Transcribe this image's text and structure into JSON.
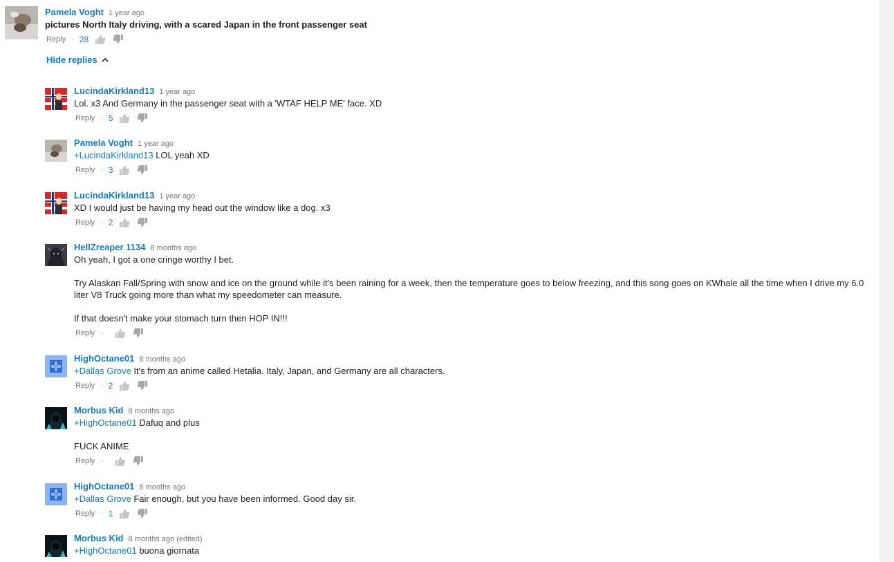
{
  "ui": {
    "reply_label": "Reply",
    "hide_replies_label": "Hide replies"
  },
  "top_comment": {
    "author": "Pamela Voght",
    "time": "1 year ago",
    "text": "pictures North Italy driving, with a scared Japan in the front passenger seat",
    "likes": "28"
  },
  "replies": [
    {
      "author": "LucindaKirkland13",
      "time": "1 year ago",
      "lines": [
        "Lol. x3 And Germany in the passenger seat with a 'WTAF HELP ME' face. XD"
      ],
      "likes": "5"
    },
    {
      "author": "Pamela Voght",
      "time": "1 year ago",
      "mention": "+LucindaKirkland13",
      "lines": [
        "LOL yeah XD"
      ],
      "likes": "3"
    },
    {
      "author": "LucindaKirkland13",
      "time": "1 year ago",
      "lines": [
        "XD I would just be having my head out the window like a dog. x3"
      ],
      "likes": "2"
    },
    {
      "author": "HellZreaper 1134",
      "time": "8 months ago",
      "lines": [
        "Oh yeah, I got a one cringe worthy I bet.",
        "Try Alaskan Fall/Spring with snow and ice on the ground while it's been raining for a week, then the temperature goes to below freezing, and this song goes on KWhale all the time when I drive my 6.0",
        "liter V8 Truck going more than what my speedometer can measure.",
        "If that doesn't make your stomach turn then HOP IN!!!"
      ],
      "likes": ""
    },
    {
      "author": "HighOctane01",
      "time": "8 months ago",
      "mention": "+Dallas Grove",
      "lines": [
        " It's from an anime called Hetalia.  Italy, Japan, and Germany are all characters."
      ],
      "likes": "2"
    },
    {
      "author": "Morbus Kid",
      "time": "8 months ago",
      "mention": "+HighOctane01",
      "lines": [
        "Dafuq and plus",
        "FUCK ANIME"
      ],
      "likes": ""
    },
    {
      "author": "HighOctane01",
      "time": "8 months ago",
      "mention": "+Dallas Grove",
      "lines": [
        "Fair enough, but you have been informed. Good day sir."
      ],
      "likes": "1"
    },
    {
      "author": "Morbus Kid",
      "time": "8 months ago (edited)",
      "mention": "+HighOctane01",
      "lines": [
        "buona giornata"
      ],
      "likes": ""
    }
  ],
  "colors": {
    "link_blue": "#167ac6",
    "meta_gray": "#767676",
    "text": "#222222",
    "scrollbar_track": "#f1f1f1"
  }
}
